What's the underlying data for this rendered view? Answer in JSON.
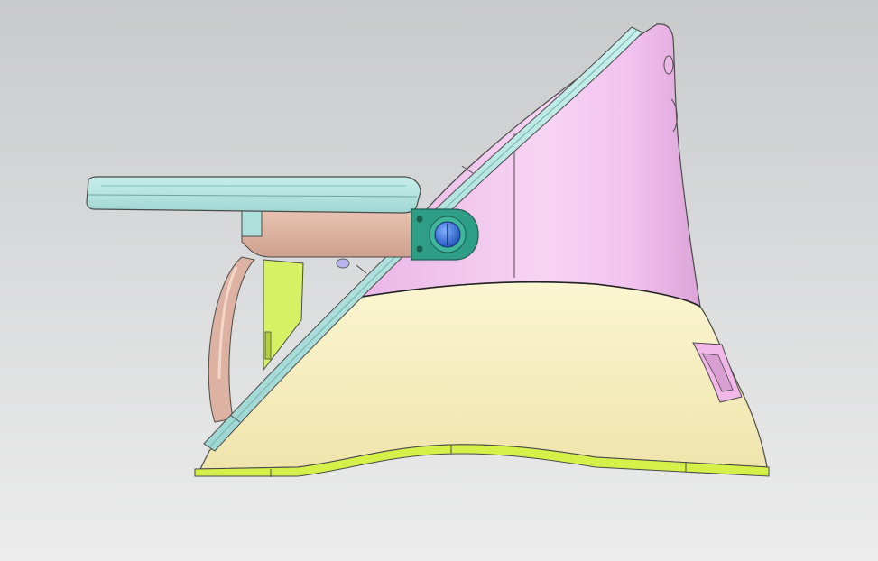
{
  "scene": {
    "subject": "",
    "view": "",
    "colors": {
      "background_top": "#c9cacb",
      "background_bottom": "#ececec",
      "base_shell": "#f8f0c4",
      "back_panel": "#f2c2f0",
      "backrest_rail": "#aee0dc",
      "tray": "#aee0dc",
      "tray_arm": "#d9b09e",
      "hinge": "#2f9e86",
      "knob": "#3a6ed8",
      "bottom_trim": "#d6f04a",
      "inner_strut": "#d8f064",
      "front_post": "#deb2a2",
      "side_handle": "#f0b7e8",
      "edge": "#4a4a4a"
    },
    "parts": [
      "base-shell",
      "back-panel",
      "backrest-rail",
      "tray",
      "tray-arm",
      "hinge",
      "knob",
      "bottom-trim",
      "inner-strut",
      "front-post",
      "side-handle"
    ]
  }
}
